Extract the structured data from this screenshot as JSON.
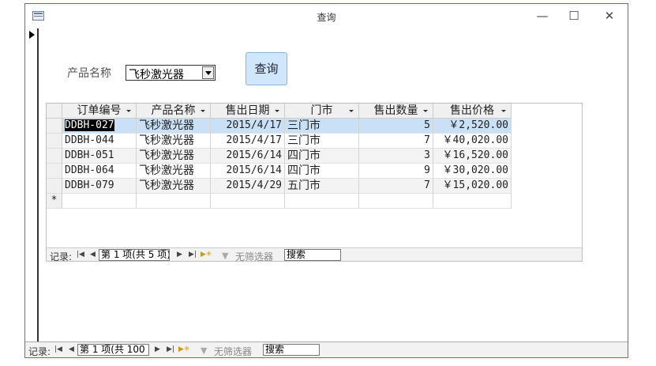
{
  "window": {
    "title": "查询"
  },
  "form": {
    "label": "产品名称",
    "combo_value": "飞秒激光器",
    "query_button": "查询"
  },
  "grid": {
    "columns": [
      "订单编号",
      "产品名称",
      "售出日期",
      "门市",
      "售出数量",
      "售出价格"
    ],
    "rows": [
      [
        "DDBH-027",
        "飞秒激光器",
        "2015/4/17",
        "三门市",
        "5",
        "￥2,520.00"
      ],
      [
        "DDBH-044",
        "飞秒激光器",
        "2015/4/17",
        "三门市",
        "7",
        "￥40,020.00"
      ],
      [
        "DDBH-051",
        "飞秒激光器",
        "2015/6/14",
        "四门市",
        "3",
        "￥16,520.00"
      ],
      [
        "DDBH-064",
        "飞秒激光器",
        "2015/6/14",
        "四门市",
        "9",
        "￥30,020.00"
      ],
      [
        "DDBH-079",
        "飞秒激光器",
        "2015/4/29",
        "五门市",
        "7",
        "￥15,020.00"
      ]
    ],
    "new_row_marker": "*"
  },
  "subform_nav": {
    "label": "记录:",
    "position": "第 1 项(共 5 项)",
    "filter": "无筛选器",
    "search": "搜索"
  },
  "form_nav": {
    "label": "记录:",
    "position": "第 1 项(共 100 项)",
    "filter": "无筛选器",
    "search": "搜索"
  }
}
